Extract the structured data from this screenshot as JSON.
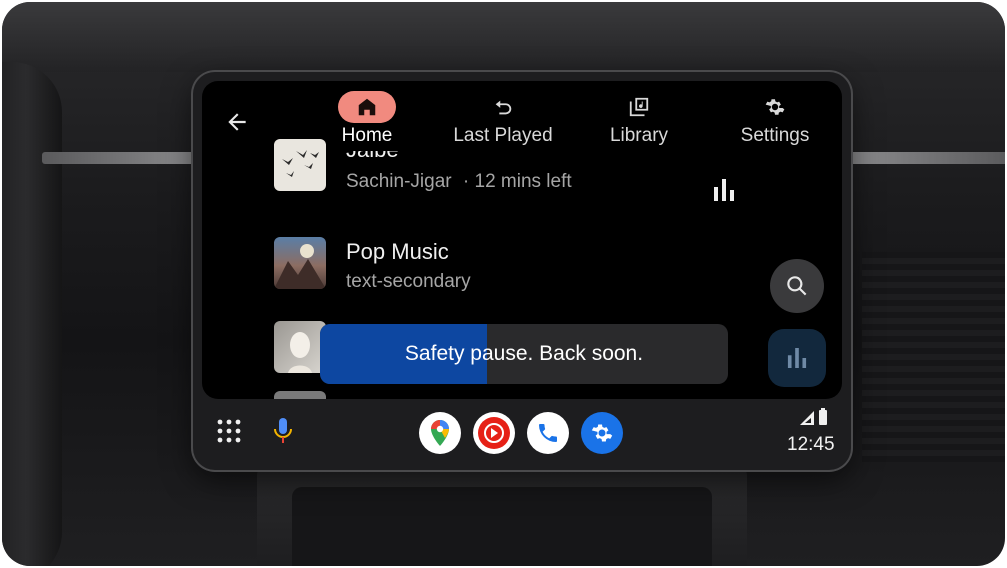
{
  "header": {
    "back_icon": "arrow-left-icon",
    "tabs": [
      {
        "label": "Home",
        "icon": "home-icon",
        "active": true
      },
      {
        "label": "Last Played",
        "icon": "history-icon",
        "active": false
      },
      {
        "label": "Library",
        "icon": "library-icon",
        "active": false
      },
      {
        "label": "Settings",
        "icon": "gear-icon",
        "active": false
      }
    ]
  },
  "list": {
    "items": [
      {
        "title": "Jalbe",
        "subtitle": "Sachin-Jigar",
        "meta": "· 12 mins left",
        "icon": "equalizer-icon"
      },
      {
        "title": "Pop Music",
        "subtitle": "text-secondary"
      }
    ]
  },
  "toast": {
    "message": "Safety pause. Back soon.",
    "progress": 0.41,
    "fill_color": "#0D47A1"
  },
  "fabs": {
    "search_icon": "search-icon",
    "now_playing_icon": "equalizer-icon"
  },
  "bottom_bar": {
    "launcher_icon": "app-grid-icon",
    "mic_icon": "mic-icon",
    "apps": [
      {
        "name": "maps-icon"
      },
      {
        "name": "youtube-music-icon"
      },
      {
        "name": "phone-icon"
      },
      {
        "name": "settings-app-icon"
      }
    ],
    "status": {
      "signal_icon": "signal-icon",
      "battery_icon": "battery-icon"
    },
    "clock": "12:45"
  },
  "colors": {
    "accent_active_tab": "#F18A7F",
    "toast_progress": "#0D47A1",
    "surface": "#000000"
  }
}
